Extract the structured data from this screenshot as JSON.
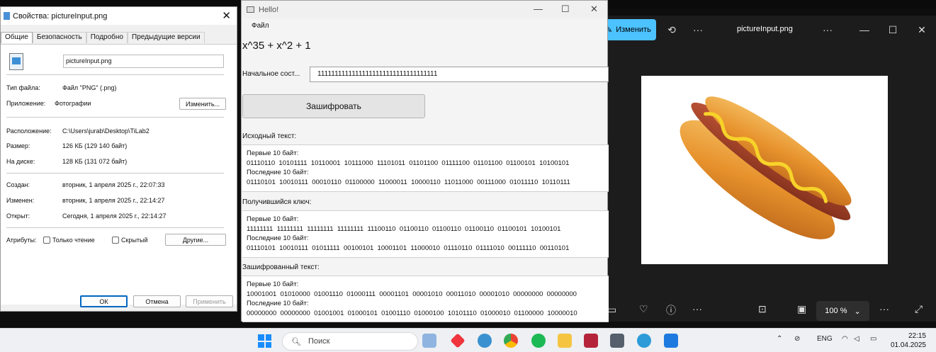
{
  "photos": {
    "edit_label": "Изменить",
    "file_name": "pictureInput.png",
    "zoom": "100 %"
  },
  "props": {
    "title": "Свойства: pictureInput.png",
    "tabs": [
      "Общие",
      "Безопасность",
      "Подробно",
      "Предыдущие версии"
    ],
    "file_name": "pictureInput.png",
    "type_label": "Тип файла:",
    "type_value": "Файл \"PNG\" (.png)",
    "app_label": "Приложение:",
    "app_value": "Фотографии",
    "change_button": "Изменить...",
    "location_label": "Расположение:",
    "location_value": "C:\\Users\\jurab\\Desktop\\TiLab2",
    "size_label": "Размер:",
    "size_value": "126 КБ (129 140 байт)",
    "disk_label": "На диске:",
    "disk_value": "128 КБ (131 072 байт)",
    "created_label": "Создан:",
    "created_value": "вторник, 1 апреля 2025 г., 22:07:33",
    "modified_label": "Изменен:",
    "modified_value": "вторник, 1 апреля 2025 г., 22:14:27",
    "opened_label": "Открыт:",
    "opened_value": "Сегодня, 1 апреля 2025 г., 22:14:27",
    "attr_label": "Атрибуты:",
    "readonly_label": "Только чтение",
    "hidden_label": "Скрытый",
    "other_button": "Другие...",
    "ok_button": "ОК",
    "cancel_button": "Отмена",
    "apply_button": "Применить"
  },
  "hello": {
    "title": "Hello!",
    "menu_file": "Файл",
    "polynomial": "x^35 + x^2 + 1",
    "init_label": "Начальное сост...",
    "init_value": "11111111111111111111111111111111111",
    "encrypt_button": "Зашифровать",
    "source_header": "Исходный текст:",
    "source_text": "Первые 10 байт:\n01110110  10101111  10110001  10111000  11101011  01101100  01111100  01101100  01100101  10100101\nПоследние 10 байт:\n01110101  10010111  00010110  01100000  11000011  10000110  11011000  00111000  01011110  10110111",
    "key_header": "Получившийся ключ:",
    "key_text": "Первые 10 байт:\n11111111  11111111  11111111  11111111  11100110  01100110  01100110  01100110  01100101  10100101\nПоследние 10 байт:\n01110101  10010111  01011111  00100101  10001101  11000010  01110110  01111010  00111110  00110101",
    "cipher_header": "Зашифрованный текст:",
    "cipher_text": "Первые 10 байт:\n10001001  01010000  01001110  01000111  00001101  00001010  00011010  00001010  00000000  00000000\nПоследние 10 байт:\n00000000  00000000  01001001  01000101  01001110  01000100  10101110  01000010  01100000  10000010"
  },
  "taskbar": {
    "search_placeholder": "Поиск",
    "lang": "ENG",
    "time": "22:15",
    "date": "01.04.2025"
  }
}
